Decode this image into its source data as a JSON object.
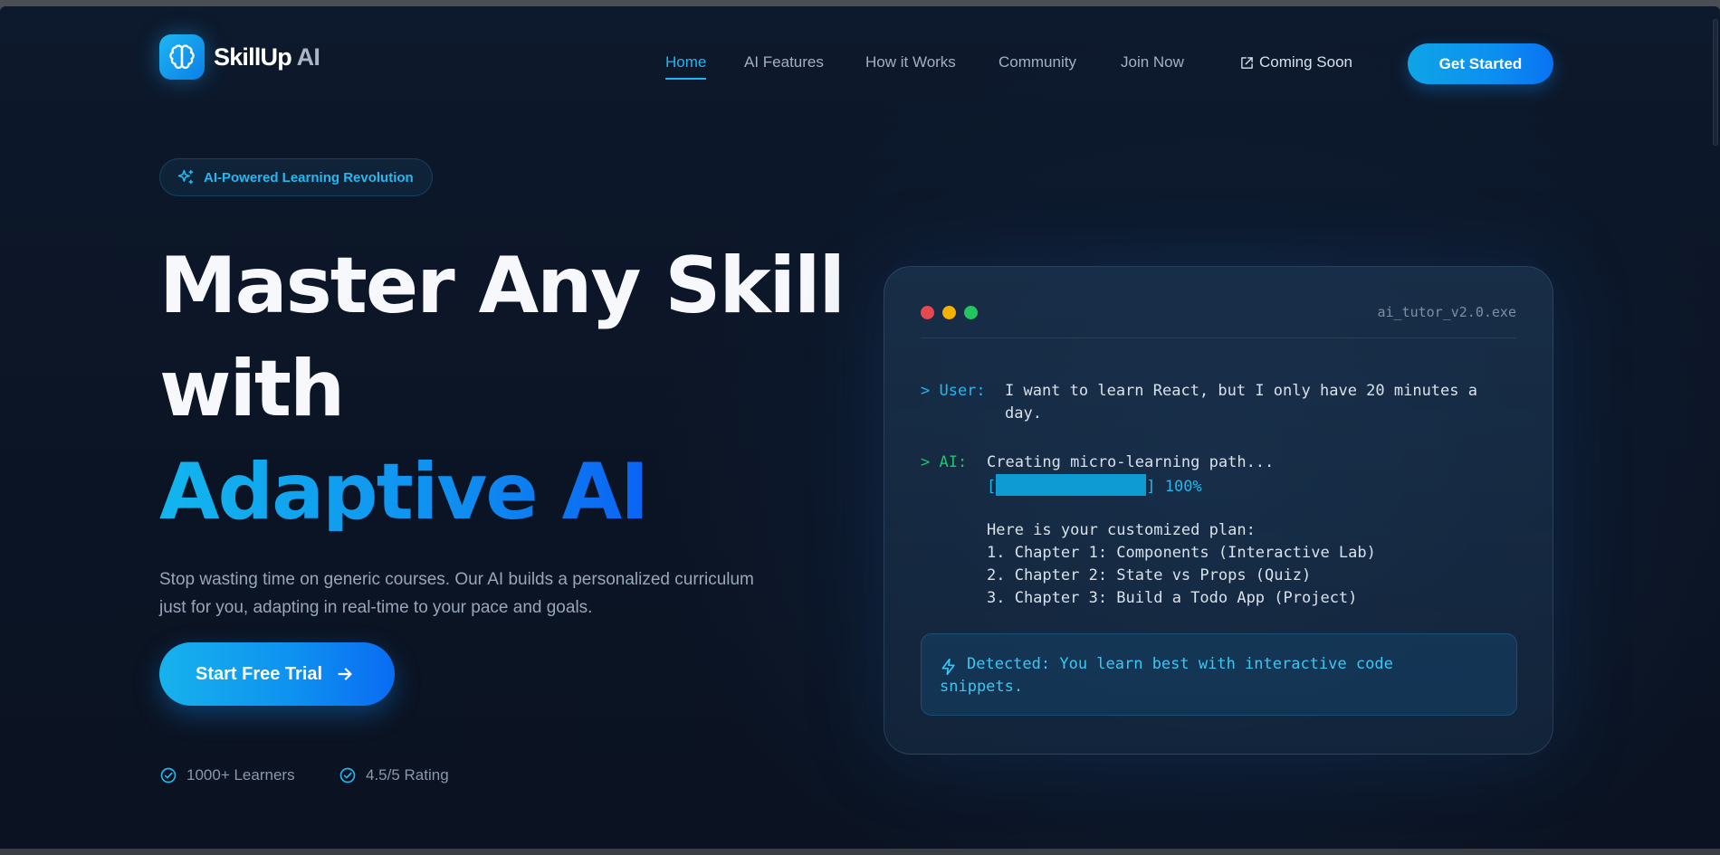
{
  "brand": {
    "name_main": "SkillUp",
    "name_ai": " AI",
    "logo_icon": "brain-icon"
  },
  "nav": {
    "items": [
      {
        "label": "Home",
        "active": true
      },
      {
        "label": "AI Features"
      },
      {
        "label": "How it Works"
      },
      {
        "label": "Community"
      },
      {
        "label": "Join Now"
      }
    ],
    "coming_soon": "Coming Soon",
    "cta": "Get Started"
  },
  "hero": {
    "badge": "AI-Powered Learning Revolution",
    "title_line1": "Master Any Skill",
    "title_line2": "with",
    "title_line3": "Adaptive AI",
    "lead": "Stop wasting time on generic courses. Our AI builds a personalized curriculum just for you, adapting in real-time to your pace and goals.",
    "cta": "Start Free Trial",
    "stats": [
      "1000+ Learners",
      "4.5/5 Rating"
    ]
  },
  "terminal": {
    "filename": "ai_tutor_v2.0.exe",
    "user_prompt": "> User:",
    "user_line1": "I want to learn React, but I only have 20 minutes a",
    "user_line2": "day.",
    "ai_prompt": "> AI:",
    "ai_line1": "Creating micro-learning path...",
    "progress_open": "[",
    "progress_close": "] 100%",
    "progress": 1.0,
    "plan_intro": "Here is your customized plan:",
    "plan": [
      "1. Chapter 1: Components (Interactive Lab)",
      "2. Chapter 2: State vs Props (Quiz)",
      "3. Chapter 3: Build a Todo App (Project)"
    ],
    "detect_line1": "Detected: You learn best with interactive code",
    "detect_line2": "snippets."
  },
  "colors": {
    "accent": "#20b6f2",
    "blue": "#0a6cf3",
    "bg": "#0b1424",
    "red": "#e5484d",
    "yellow": "#f5b000",
    "green": "#22c55e"
  }
}
